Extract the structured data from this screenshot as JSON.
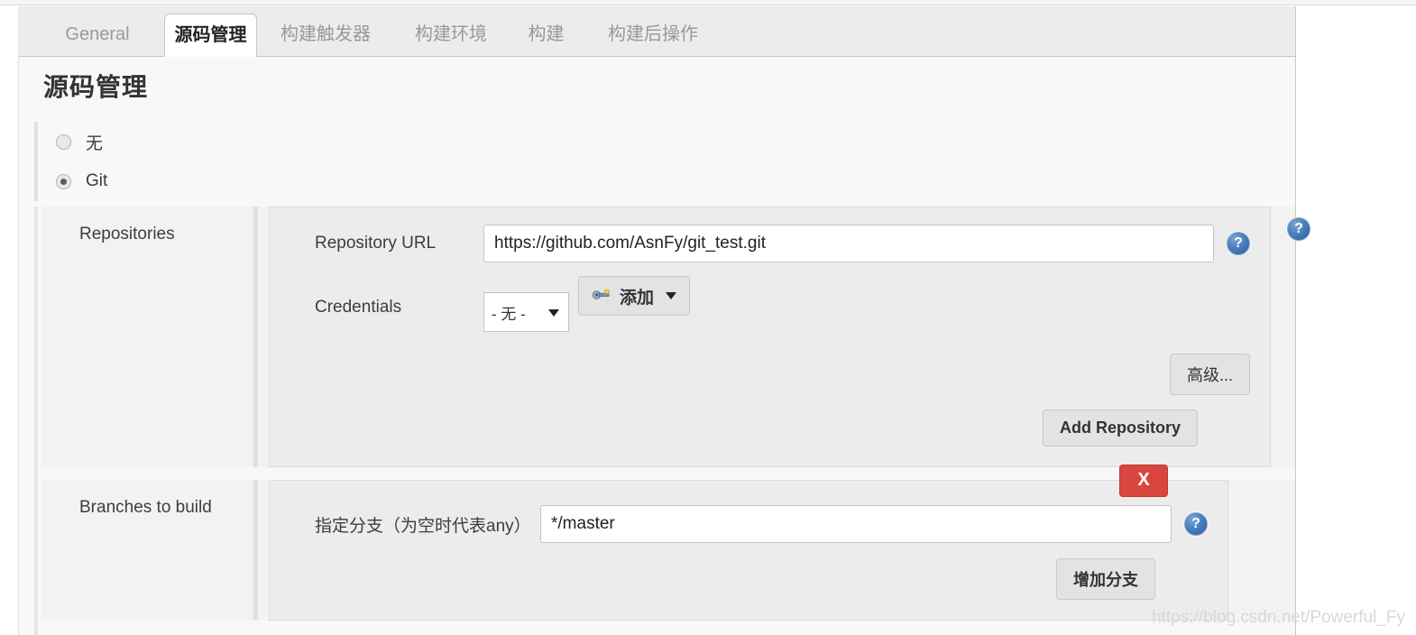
{
  "page": {
    "title": "源码管理",
    "watermark": "https://blog.csdn.net/Powerful_Fy"
  },
  "tabs": [
    {
      "label": "General",
      "active": false
    },
    {
      "label": "源码管理",
      "active": true
    },
    {
      "label": "构建触发器",
      "active": false
    },
    {
      "label": "构建环境",
      "active": false
    },
    {
      "label": "构建",
      "active": false
    },
    {
      "label": "构建后操作",
      "active": false
    }
  ],
  "scm_options": [
    {
      "label": "无",
      "selected": false
    },
    {
      "label": "Git",
      "selected": true
    }
  ],
  "repositories": {
    "section_label": "Repositories",
    "repository_url": {
      "label": "Repository URL",
      "value": "https://github.com/AsnFy/git_test.git"
    },
    "credentials": {
      "label": "Credentials",
      "selected": "- 无 -",
      "add_button": "添加",
      "add_icon": "key-icon"
    },
    "advanced_button": "高级...",
    "add_repository_button": "Add Repository",
    "help_icon": "help-icon"
  },
  "branches": {
    "section_label": "Branches to build",
    "branch_specifier": {
      "label": "指定分支（为空时代表any）",
      "value": "*/master"
    },
    "delete_button": "X",
    "add_branch_button": "增加分支",
    "help_icon": "help-icon"
  },
  "colors": {
    "danger": "#d9463f",
    "help_blue": "#2d5d99",
    "panel_bg": "#f8f8f8",
    "block_bg": "#ececec"
  }
}
